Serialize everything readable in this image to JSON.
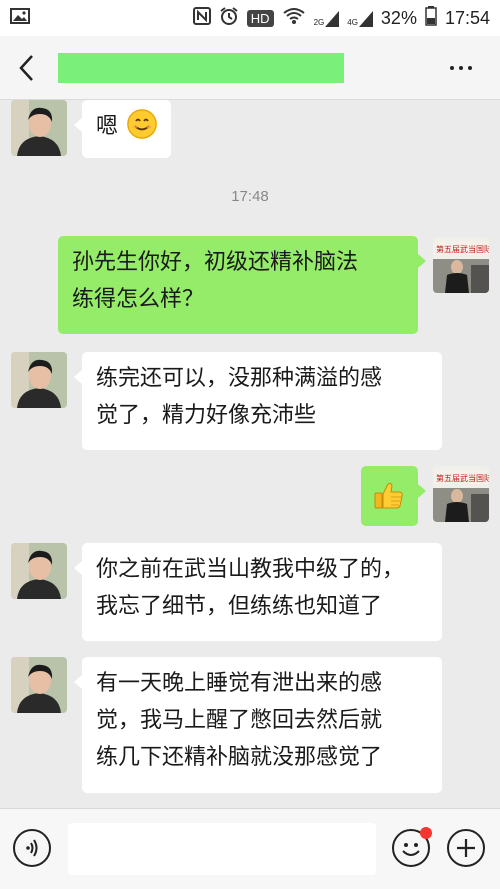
{
  "status_bar": {
    "hd_label": "HD",
    "net_2g": "2G",
    "net_4g": "4G",
    "battery": "32%",
    "time": "17:54"
  },
  "header": {
    "title": "",
    "title_mask_color": "#7af07a"
  },
  "colors": {
    "incoming_bubble": "#ffffff",
    "outgoing_bubble": "#95ec69",
    "background": "#ebebeb"
  },
  "timestamp": "17:48",
  "messages": [
    {
      "side": "in",
      "lines": [
        "嗯"
      ],
      "emoji": "smiling-face-icon"
    },
    {
      "side": "out",
      "lines": [
        "孙先生你好，初级还精补脑法",
        "练得怎么样？"
      ]
    },
    {
      "side": "in",
      "lines": [
        "练完还可以，没那种满溢的感",
        "觉了，精力好像充沛些"
      ]
    },
    {
      "side": "out",
      "lines": [],
      "emoji": "thumbs-up-icon"
    },
    {
      "side": "in",
      "lines": [
        "你之前在武当山教我中级了的，",
        "我忘了细节，但练练也知道了"
      ]
    },
    {
      "side": "in",
      "lines": [
        "有一天晚上睡觉有泄出来的感",
        "觉，我马上醒了憋回去然后就",
        "练几下还精补脑就没那感觉了"
      ]
    }
  ],
  "outgoing_avatar_banner": "第五届武当国际演武大",
  "input": {
    "placeholder": ""
  }
}
